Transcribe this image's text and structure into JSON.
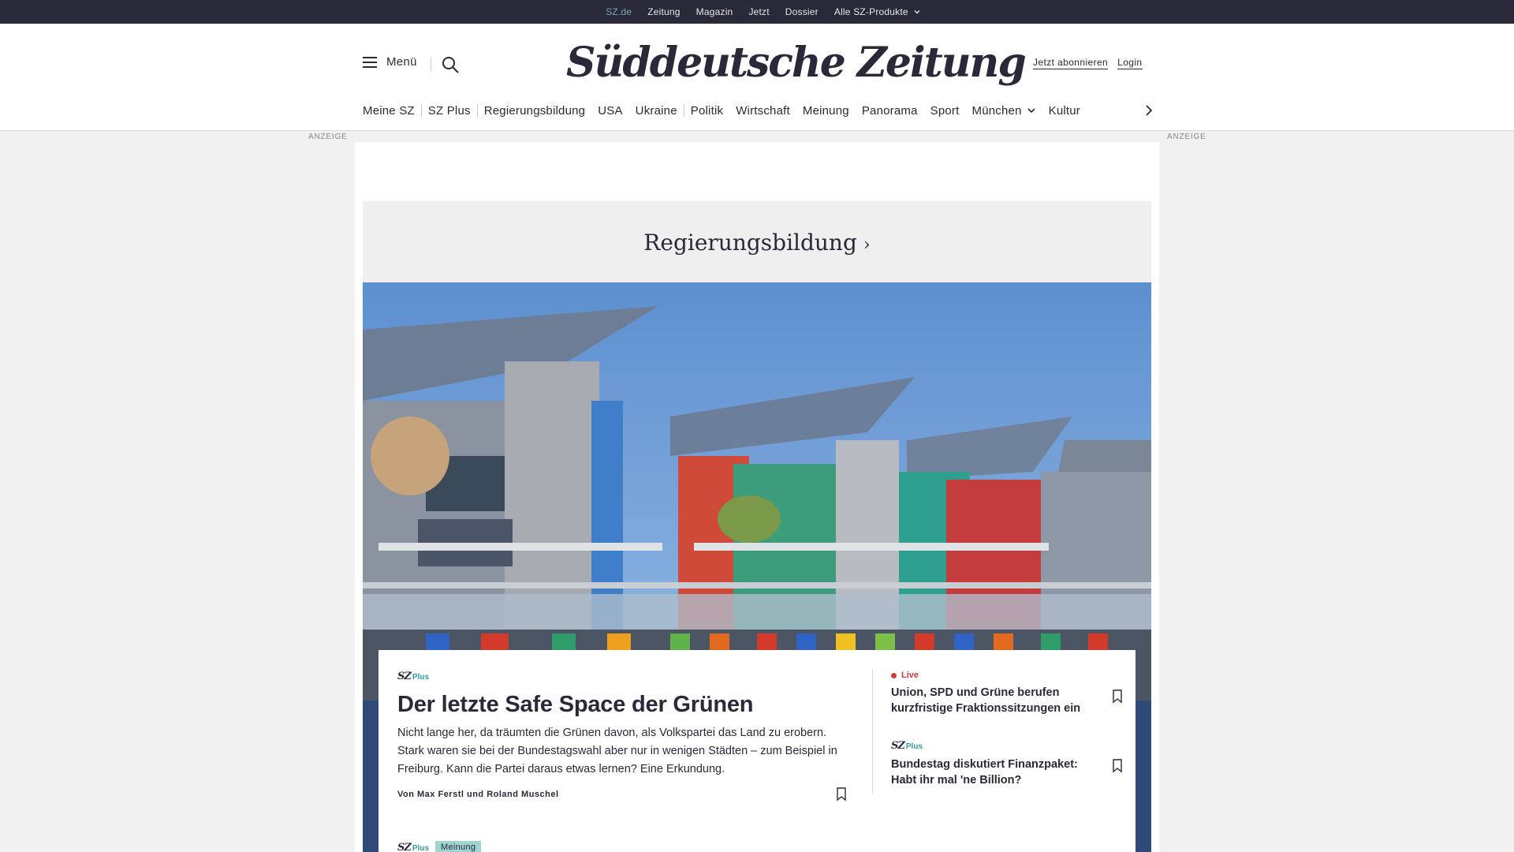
{
  "topbar": {
    "links": [
      "SZ.de",
      "Zeitung",
      "Magazin",
      "Jetzt",
      "Dossier",
      "Alle SZ-Produkte"
    ]
  },
  "header": {
    "menu_label": "Menü",
    "logo_text": "Süddeutsche Zeitung",
    "subscribe_label": "Jetzt abonnieren",
    "login_label": "Login"
  },
  "nav": {
    "items": [
      "Meine SZ",
      "SZ Plus",
      "Regierungsbildung",
      "USA",
      "Ukraine",
      "Politik",
      "Wirtschaft",
      "Meinung",
      "Panorama",
      "Sport",
      "München",
      "Kultur"
    ]
  },
  "ads": {
    "label_left": "ANZEIGE",
    "label_right": "ANZEIGE"
  },
  "section": {
    "title": "Regierungsbildung"
  },
  "lead": {
    "brand_sz": "SZ",
    "brand_plus": "Plus",
    "title": "Der letzte Safe Space der Grünen",
    "teaser": "Nicht lange her, da träumten die Grünen davon, als Volkspartei das Land zu erobern. Stark waren sie bei der Bundestagswahl aber nur in wenigen Städten – zum Beispiel in Freiburg. Kann die Partei daraus etwas lernen? Eine Erkundung.",
    "author": "Von Max Ferstl und Roland Muschel"
  },
  "side": [
    {
      "label": "Live",
      "title": "Union, SPD und Grüne berufen kurzfristige Fraktionssitzungen ein"
    },
    {
      "brand_sz": "SZ",
      "brand_plus": "Plus",
      "title": "Bundestag diskutiert Finanzpaket: Habt ihr mal 'ne Billion?"
    }
  ],
  "next": {
    "brand_sz": "SZ",
    "brand_plus": "Plus",
    "badge": "Meinung"
  },
  "colors": {
    "topbar": "#29293a",
    "accent": "#7ba8b6",
    "plus": "#2f9e9e",
    "live": "#d23a3a",
    "badge": "#9fd4d0"
  }
}
